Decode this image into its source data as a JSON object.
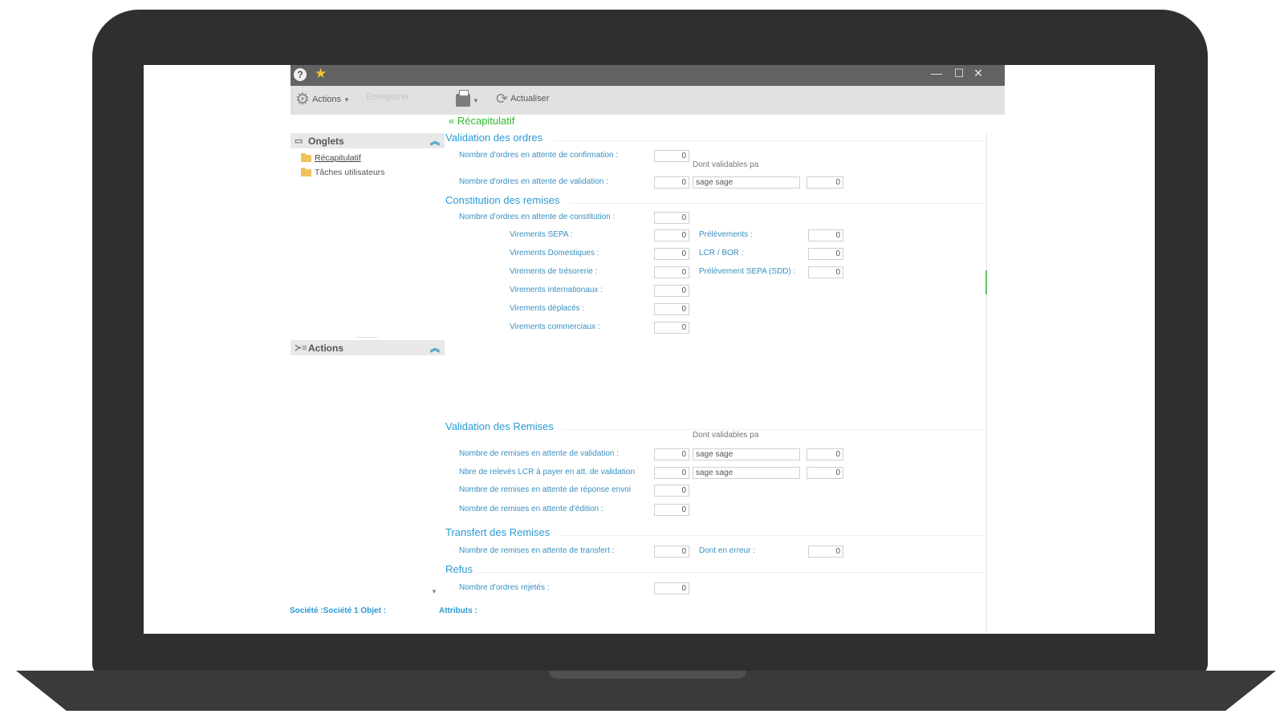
{
  "titlebar": {
    "help_icon": "?",
    "minimize": "—",
    "maximize": "☐",
    "close": "✕"
  },
  "toolbar": {
    "actions_label": "Actions",
    "save_label": "Enregistrer",
    "refresh_label": "Actualiser"
  },
  "left_panel": {
    "tabs_header": "Onglets",
    "items": [
      {
        "label": "Récapitulatif"
      },
      {
        "label": "Tâches utilisateurs"
      }
    ],
    "actions_header": "Actions"
  },
  "breadcrumb": "« Récapitulatif",
  "sections": {
    "validation_ordres": {
      "title": "Validation des ordres",
      "confirmation_label": "Nombre d'ordres en attente de confirmation :",
      "confirmation_value": "0",
      "dont_validables": "Dont validables pa",
      "validation_label": "Nombre d'ordres en attente de validation :",
      "validation_value": "0",
      "validation_user": "sage sage",
      "validation_user_count": "0"
    },
    "constitution_remises": {
      "title": "Constitution des remises",
      "constitution_label": "Nombre d'ordres en attente de constitution :",
      "constitution_value": "0",
      "left_rows": [
        {
          "label": "Virements SEPA :",
          "value": "0"
        },
        {
          "label": "Virements Domestiques :",
          "value": "0"
        },
        {
          "label": "Virements de trésorerie :",
          "value": "0"
        },
        {
          "label": "Virements internationaux :",
          "value": "0"
        },
        {
          "label": "Virements déplacés :",
          "value": "0"
        },
        {
          "label": "Virements commerciaux :",
          "value": "0"
        }
      ],
      "right_rows": [
        {
          "label": "Prélèvements :",
          "value": "0"
        },
        {
          "label": "LCR / BOR :",
          "value": "0"
        },
        {
          "label": "Prélèvement SEPA (SDD) :",
          "value": "0"
        }
      ]
    },
    "validation_remises": {
      "title": "Validation des Remises",
      "dont_validables": "Dont validables pa",
      "rows": [
        {
          "label": "Nombre de remises en attente de validation :",
          "value": "0",
          "user": "sage sage",
          "user_count": "0"
        },
        {
          "label": "Nbre de relevés LCR à payer en att. de validation",
          "value": "0",
          "user": "sage sage",
          "user_count": "0"
        },
        {
          "label": "Nombre de remises en attente de réponse envoi",
          "value": "0"
        },
        {
          "label": "Nombre de remises en attente d'édition :",
          "value": "0"
        }
      ]
    },
    "transfert_remises": {
      "title": "Transfert des Remises",
      "transfer_label": "Nombre de remises en attente de transfert :",
      "transfer_value": "0",
      "error_label": "Dont en erreur :",
      "error_value": "0"
    },
    "refus": {
      "title": "Refus",
      "rejected_label": "Nombre d'ordres rejetés :",
      "rejected_value": "0"
    }
  },
  "status_bar": {
    "company": "Société :Société 1  Objet :",
    "attributes": "Attributs :"
  },
  "colors": {
    "accent_blue": "#2a9bd3",
    "breadcrumb_green": "#2bbd2b",
    "titlebar": "#626262",
    "laptop_body": "#2f2f31"
  }
}
